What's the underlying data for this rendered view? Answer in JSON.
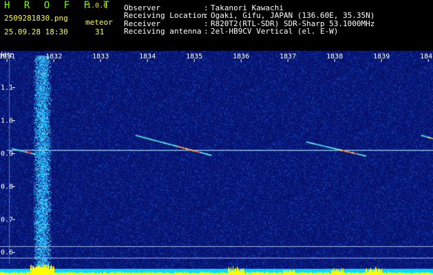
{
  "app": {
    "name": "H R O F F T",
    "version": "1.0.0",
    "filename": "2509281830.png",
    "datetime": "25.09.28 18:30",
    "meteor_label": "meteor",
    "meteor_count": "31"
  },
  "info": [
    {
      "key": "Observer",
      "sep": ":",
      "value": "Takanori Kawachi"
    },
    {
      "key": "Receiving Location",
      "sep": ":",
      "value": "Ogaki, Gifu, JAPAN (136.60E, 35.35N)"
    },
    {
      "key": "Receiver",
      "sep": ":",
      "value": "R820T2(RTL-SDR) SDR-Sharp 53.1000MHz"
    },
    {
      "key": "Receiving antenna",
      "sep": ":",
      "value": "2el-HB9CV Vertical (el. E-W)"
    }
  ],
  "colors": {
    "title_green": "#7cfc00",
    "text_yellow": "#ffff33",
    "background_blue": "#0a1a7a",
    "baseline_cyan": "#00d8ff",
    "signal_yellow": "#ffff00"
  },
  "chart_data": {
    "type": "heatmap",
    "y_unit": "kHz",
    "x_ticks": [
      "1831",
      "1832",
      "1833",
      "1834",
      "1835",
      "1836",
      "1837",
      "1838",
      "1839",
      "1840"
    ],
    "x_tick_values": [
      1831,
      1832,
      1833,
      1834,
      1835,
      1836,
      1837,
      1838,
      1839,
      1840
    ],
    "y_ticks": [
      "1.1",
      "1.0",
      "0.9",
      "0.8",
      "0.7",
      "0.6"
    ],
    "y_tick_values": [
      1.1,
      1.0,
      0.9,
      0.8,
      0.7,
      0.6
    ],
    "xlim": [
      1830.85,
      1840.1
    ],
    "ylim": [
      0.565,
      1.195
    ],
    "carrier_khz": 0.91,
    "strong_band_x": [
      1831.55,
      1831.95
    ],
    "vertical_line_x": 1831.05,
    "meteor_streaks": [
      {
        "x": [
          1833.75,
          1835.35
        ],
        "y": [
          0.955,
          0.895
        ]
      },
      {
        "x": [
          1837.4,
          1838.65
        ],
        "y": [
          0.935,
          0.893
        ]
      },
      {
        "x": [
          1831.1,
          1831.6
        ],
        "y": [
          0.915,
          0.898
        ]
      },
      {
        "x": [
          1839.85,
          1840.1
        ],
        "y": [
          0.955,
          0.945
        ]
      }
    ],
    "grid": false
  }
}
